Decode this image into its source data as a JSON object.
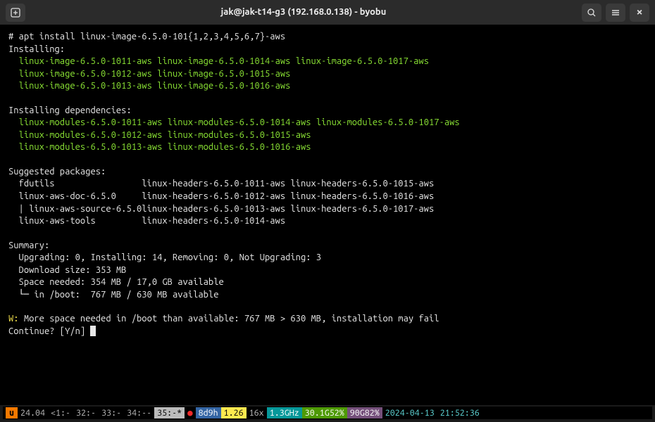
{
  "titlebar": {
    "title": "jak@jak-t14-g3 (192.168.0.138) - byobu"
  },
  "term": {
    "cmd_prompt": "# ",
    "cmd": "apt install linux-image-6.5.0-101{1,2,3,4,5,6,7}-aws",
    "installing_label": "Installing:",
    "installing": [
      [
        "linux-image-6.5.0-1011-aws",
        "linux-image-6.5.0-1014-aws",
        "linux-image-6.5.0-1017-aws"
      ],
      [
        "linux-image-6.5.0-1012-aws",
        "linux-image-6.5.0-1015-aws"
      ],
      [
        "linux-image-6.5.0-1013-aws",
        "linux-image-6.5.0-1016-aws"
      ]
    ],
    "deps_label": "Installing dependencies:",
    "deps": [
      [
        "linux-modules-6.5.0-1011-aws",
        "linux-modules-6.5.0-1014-aws",
        "linux-modules-6.5.0-1017-aws"
      ],
      [
        "linux-modules-6.5.0-1012-aws",
        "linux-modules-6.5.0-1015-aws"
      ],
      [
        "linux-modules-6.5.0-1013-aws",
        "linux-modules-6.5.0-1016-aws"
      ]
    ],
    "suggested_label": "Suggested packages:",
    "suggested": [
      [
        "fdutils",
        "linux-headers-6.5.0-1011-aws",
        "linux-headers-6.5.0-1015-aws"
      ],
      [
        "linux-aws-doc-6.5.0",
        "linux-headers-6.5.0-1012-aws",
        "linux-headers-6.5.0-1016-aws"
      ],
      [
        "| linux-aws-source-6.5.0",
        "linux-headers-6.5.0-1013-aws",
        "linux-headers-6.5.0-1017-aws"
      ],
      [
        "linux-aws-tools",
        "linux-headers-6.5.0-1014-aws"
      ]
    ],
    "summary_label": "Summary:",
    "summary_counts": "  Upgrading: 0, Installing: 14, Removing: 0, Not Upgrading: 3",
    "summary_download": "  Download size: 353 MB",
    "summary_space": "  Space needed: 354 MB / 17,0 GB available",
    "summary_boot": "  └─ in /boot:  767 MB / 630 MB available",
    "warn_prefix": "W:",
    "warn_text": " More space needed in /boot than available: 767 MB > 630 MB, installation may fail",
    "continue": "Continue? [Y/n] "
  },
  "status": {
    "u": "u",
    "version": "24.04",
    "load": "<1:-",
    "w32": "32:-",
    "w33": "33:-",
    "w34": "34:--",
    "w35": "35:-*",
    "dot": "●",
    "uptime": "8d9h",
    "la": "1.26",
    "cores": "16x",
    "freq": "1.3GHz",
    "mem": "30.1G52%",
    "disk": "90G82%",
    "date": "2024-04-13",
    "time": "21:52:36"
  }
}
